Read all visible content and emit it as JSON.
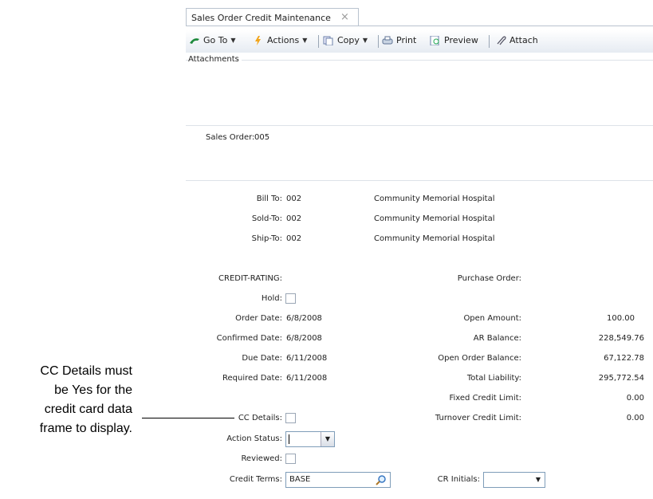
{
  "window": {
    "tab_title": "Sales Order Credit Maintenance",
    "tab_close": "×"
  },
  "toolbar": {
    "goto": "Go To",
    "actions": "Actions",
    "copy": "Copy",
    "print": "Print",
    "preview": "Preview",
    "attach": "Attach"
  },
  "attachments_label": "Attachments",
  "sales_order": {
    "label": "Sales Order:",
    "value": "005"
  },
  "addresses": [
    {
      "label": "Bill To:",
      "code": "002",
      "name": "Community Memorial Hospital"
    },
    {
      "label": "Sold-To:",
      "code": "002",
      "name": "Community Memorial Hospital"
    },
    {
      "label": "Ship-To:",
      "code": "002",
      "name": "Community Memorial Hospital"
    }
  ],
  "credit_rating_label": "CREDIT-RATING:",
  "purchase_order_label": "Purchase Order:",
  "hold_label": "Hold:",
  "dates": [
    {
      "label": "Order Date:",
      "value": "6/8/2008"
    },
    {
      "label": "Confirmed Date:",
      "value": "6/8/2008"
    },
    {
      "label": "Due Date:",
      "value": "6/11/2008"
    },
    {
      "label": "Required Date:",
      "value": "6/11/2008"
    }
  ],
  "balances": [
    {
      "label": "Open Amount:",
      "value": "100.00"
    },
    {
      "label": "AR Balance:",
      "value": "228,549.76"
    },
    {
      "label": "Open Order Balance:",
      "value": "67,122.78"
    },
    {
      "label": "Total Liability:",
      "value": "295,772.54"
    },
    {
      "label": "Fixed Credit Limit:",
      "value": "0.00"
    },
    {
      "label": "Turnover Credit Limit:",
      "value": "0.00"
    }
  ],
  "cc_details_label": "CC Details:",
  "action_status_label": "Action Status:",
  "action_status_value": "",
  "reviewed_label": "Reviewed:",
  "credit_terms_label": "Credit Terms:",
  "credit_terms_value": "BASE",
  "cr_initials_label": "CR Initials:",
  "cr_initials_value": "",
  "callout_lines": [
    "CC Details must",
    "be Yes for the",
    "credit card data",
    "frame to display."
  ]
}
